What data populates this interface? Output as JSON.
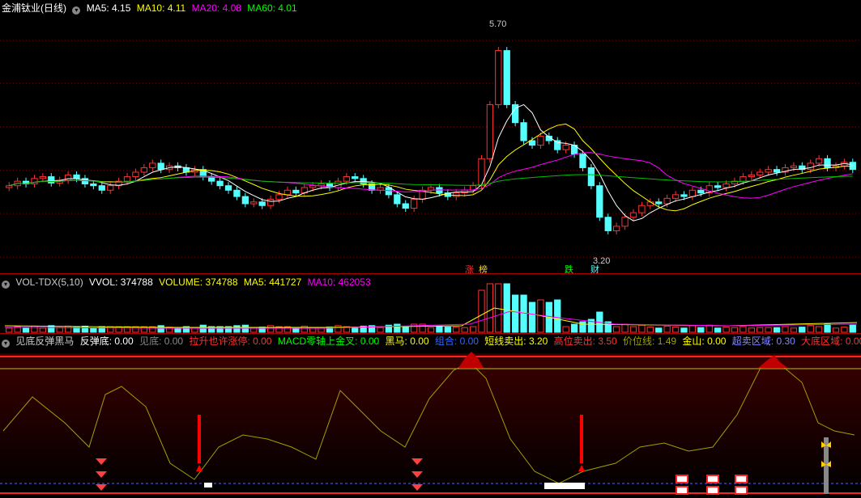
{
  "price_header": {
    "title": "金浦钛业(日线)",
    "ma5": "MA5: 4.15",
    "ma10": "MA10: 4.11",
    "ma20": "MA20: 4.08",
    "ma60": "MA60: 4.01"
  },
  "price_labels": {
    "high": "5.70",
    "low": "3.20",
    "tag1": "涨",
    "tag2": "榜",
    "tag3": "跌",
    "tag4": "财"
  },
  "vol_header": {
    "name": "VOL-TDX(5,10)",
    "vvol": "VVOL: 374788",
    "volume": "VOLUME: 374788",
    "ma5": "MA5: 441727",
    "ma10": "MA10: 462053"
  },
  "ind_header": {
    "name": "见底反弹黑马",
    "i1": "反弹底: 0.00",
    "i2": "见底: 0.00",
    "i3": "拉升也许涨停: 0.00",
    "i4": "MACD零轴上金叉: 0.00",
    "i5": "黑马: 0.00",
    "i6": "组合: 0.00",
    "i7": "短线卖出: 3.20",
    "i8": "高位卖出: 3.50",
    "i9": "价位线: 1.49",
    "i10": "金山: 0.00",
    "i11": "超卖区域: 0.30",
    "i12": "大底区域: 0.00"
  },
  "colors": {
    "up": "#ff3232",
    "down": "#54ffff",
    "ma5": "#ffffff",
    "ma10": "#ffff00",
    "ma20": "#ff00ff",
    "ma60": "#00c000",
    "grid": "#8b0000"
  },
  "chart_data": {
    "type": "candlestick",
    "ylim": [
      3.1,
      5.9
    ],
    "closes": [
      4.0,
      4.05,
      4.02,
      4.08,
      4.1,
      4.03,
      4.06,
      4.12,
      4.08,
      4.02,
      4.0,
      3.95,
      4.0,
      4.05,
      4.1,
      4.15,
      4.2,
      4.25,
      4.18,
      4.22,
      4.2,
      4.15,
      4.18,
      4.1,
      4.05,
      4.0,
      3.95,
      3.88,
      3.8,
      3.82,
      3.78,
      3.85,
      3.9,
      3.95,
      3.92,
      3.98,
      4.0,
      4.02,
      3.98,
      4.05,
      4.1,
      4.08,
      4.02,
      3.95,
      3.98,
      3.9,
      3.8,
      3.75,
      3.85,
      3.95,
      3.98,
      3.92,
      3.88,
      3.92,
      3.95,
      4.0,
      4.3,
      4.9,
      5.5,
      4.9,
      4.7,
      4.5,
      4.45,
      4.55,
      4.5,
      4.4,
      4.45,
      4.35,
      4.2,
      4.0,
      3.65,
      3.5,
      3.55,
      3.65,
      3.7,
      3.78,
      3.82,
      3.8,
      3.86,
      3.9,
      3.88,
      3.95,
      3.92,
      4.0,
      3.98,
      4.02,
      4.05,
      4.1,
      4.12,
      4.15,
      4.18,
      4.15,
      4.2,
      4.22,
      4.18,
      4.25,
      4.3,
      4.2,
      4.22,
      4.26,
      4.18
    ]
  }
}
